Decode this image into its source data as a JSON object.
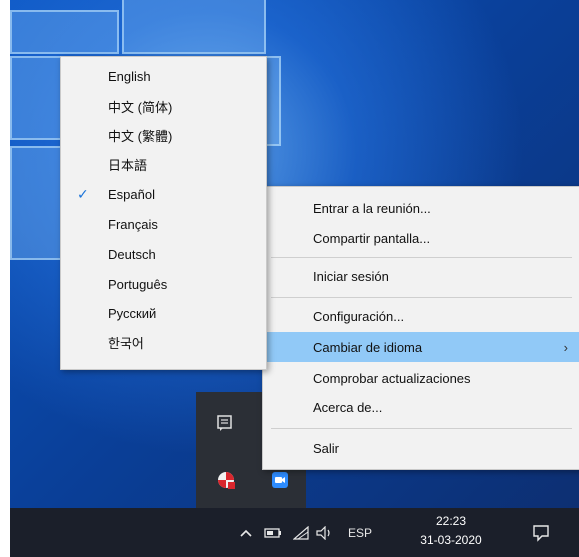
{
  "language_menu": {
    "items": [
      {
        "label": "English"
      },
      {
        "label": "中文 (简体)"
      },
      {
        "label": "中文 (繁體)"
      },
      {
        "label": "日本語"
      },
      {
        "label": "Español",
        "checked": true
      },
      {
        "label": "Français"
      },
      {
        "label": "Deutsch"
      },
      {
        "label": "Português"
      },
      {
        "label": "Русский"
      },
      {
        "label": "한국어"
      }
    ],
    "check_glyph": "✓"
  },
  "context_menu": {
    "items": [
      {
        "label": "Entrar a la reunión..."
      },
      {
        "label": "Compartir pantalla..."
      },
      {
        "label": "Iniciar sesión"
      },
      {
        "label": "Configuración..."
      },
      {
        "label": "Cambiar de idioma",
        "highlighted": true,
        "has_submenu": true
      },
      {
        "label": "Comprobar actualizaciones"
      },
      {
        "label": "Acerca de..."
      },
      {
        "label": "Salir"
      }
    ],
    "submenu_glyph": "›",
    "highlight_color": "#91c9f7"
  },
  "taskbar": {
    "input_language": "ESP",
    "clock": {
      "time": "22:23",
      "date": "31-03-2020"
    },
    "icons": [
      "chevron-up-icon",
      "battery-icon",
      "wifi-icon",
      "volume-icon",
      "notification-icon"
    ]
  },
  "tray_popup": {
    "icons": [
      "clipboard-icon",
      "app-shield-icon",
      "zoom-app-icon"
    ]
  }
}
